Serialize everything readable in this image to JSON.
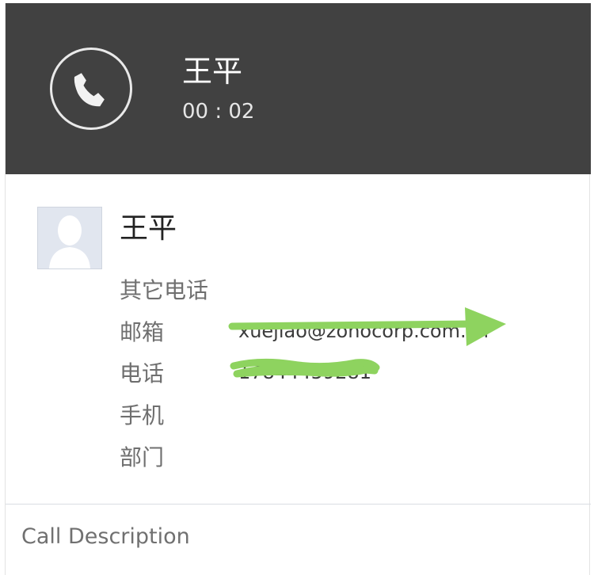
{
  "call": {
    "caller_name": "王平",
    "timer": "00 : 02",
    "icon": "phone-icon"
  },
  "contact": {
    "name": "王平",
    "avatar_icon": "default-user-avatar",
    "fields": [
      {
        "label": "其它电话",
        "value": ""
      },
      {
        "label": "邮箱",
        "value": "xuejiao@zohocorp.com.cn"
      },
      {
        "label": "电话",
        "value": "17844459281"
      },
      {
        "label": "手机",
        "value": ""
      },
      {
        "label": "部门",
        "value": ""
      }
    ]
  },
  "description": {
    "label": "Call Description"
  },
  "colors": {
    "header_bg": "#414141",
    "annotation_green": "#8ed35f"
  }
}
